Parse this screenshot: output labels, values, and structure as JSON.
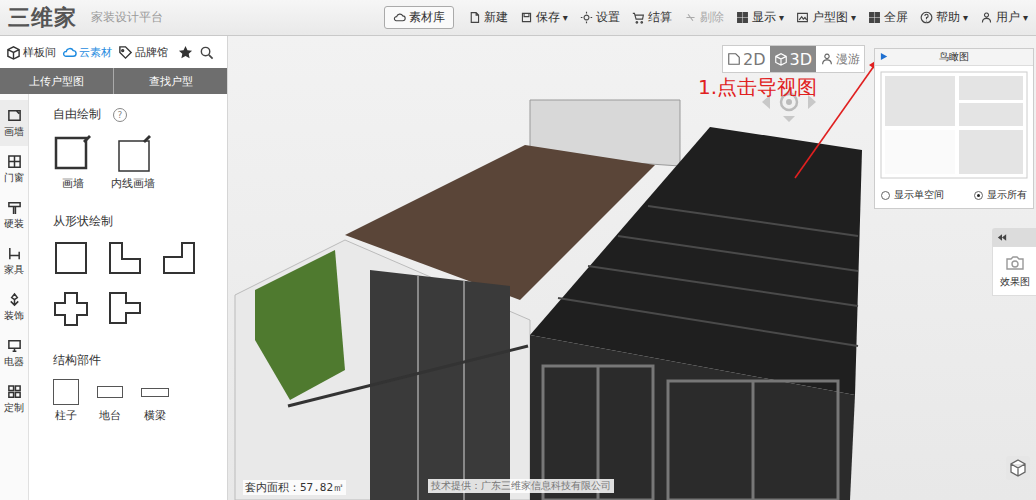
{
  "topbar": {
    "logo": "三维家",
    "subtitle": "家装设计平台",
    "caret": "▾",
    "menu": [
      {
        "label": "素材库",
        "kind": "button",
        "dropdown": false,
        "disabled": false
      },
      {
        "label": "新建",
        "kind": "item",
        "dropdown": false,
        "disabled": false
      },
      {
        "label": "保存",
        "kind": "item",
        "dropdown": true,
        "disabled": false
      },
      {
        "label": "设置",
        "kind": "item",
        "dropdown": false,
        "disabled": false
      },
      {
        "label": "结算",
        "kind": "item",
        "dropdown": false,
        "disabled": false
      },
      {
        "label": "剔除",
        "kind": "item",
        "dropdown": false,
        "disabled": true
      },
      {
        "label": "显示",
        "kind": "item",
        "dropdown": true,
        "disabled": false
      },
      {
        "label": "户型图",
        "kind": "item",
        "dropdown": true,
        "disabled": false
      },
      {
        "label": "全屏",
        "kind": "item",
        "dropdown": false,
        "disabled": false
      },
      {
        "label": "帮助",
        "kind": "item",
        "dropdown": true,
        "disabled": false
      },
      {
        "label": "用户",
        "kind": "item",
        "dropdown": true,
        "disabled": false
      }
    ]
  },
  "library": {
    "tabs": [
      {
        "label": "样板间",
        "selected": false
      },
      {
        "label": "云素材",
        "selected": true
      },
      {
        "label": "品牌馆",
        "selected": false
      }
    ],
    "actions": [
      "上传户型图",
      "查找户型"
    ]
  },
  "categories": [
    {
      "label": "画墙",
      "selected": true
    },
    {
      "label": "门窗",
      "selected": false
    },
    {
      "label": "硬装",
      "selected": false
    },
    {
      "label": "家具",
      "selected": false
    },
    {
      "label": "装饰",
      "selected": false
    },
    {
      "label": "电器",
      "selected": false
    },
    {
      "label": "定制",
      "selected": false
    }
  ],
  "tools": {
    "free_draw": {
      "title": "自由绘制",
      "help": "?",
      "items": [
        "画墙",
        "内线画墙"
      ]
    },
    "shape_draw": {
      "title": "从形状绘制"
    },
    "structure": {
      "title": "结构部件",
      "items": [
        "柱子",
        "地台",
        "横梁"
      ]
    }
  },
  "canvas": {
    "view_modes": [
      {
        "label": "2D",
        "selected": false
      },
      {
        "label": "3D",
        "selected": true
      },
      {
        "label": "漫游",
        "selected": false
      }
    ],
    "annotation": "1.点击导视图",
    "minimap": {
      "title": "鸟瞰图",
      "options": [
        {
          "label": "显示单空间",
          "selected": false
        },
        {
          "label": "显示所有",
          "selected": true
        }
      ]
    },
    "render_panel": {
      "label": "效果图"
    },
    "area": "套内面积：57.82㎡",
    "credit": "技术提供：广东三维家信息科技有限公司"
  }
}
